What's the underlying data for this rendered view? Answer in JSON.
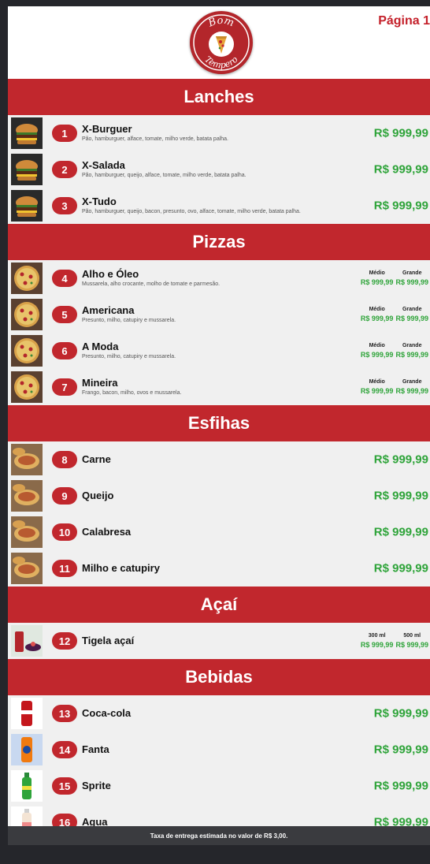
{
  "header": {
    "logo_text_top": "Bom",
    "logo_text_bottom": "Tempero",
    "page_label": "Página 1"
  },
  "sections": [
    {
      "title": "Lanches",
      "items": [
        {
          "number": "1",
          "name": "X-Burguer",
          "description": "Pão, hamburguer, alface, tomate, milho verde, batata palha.",
          "price": "R$ 999,99",
          "thumb": "burger-photo"
        },
        {
          "number": "2",
          "name": "X-Salada",
          "description": "Pão, hamburguer, queijo, alface, tomate, milho verde, batata palha.",
          "price": "R$ 999,99",
          "thumb": "burger-photo"
        },
        {
          "number": "3",
          "name": "X-Tudo",
          "description": "Pão, hamburguer, queijo, bacon, presunto, ovo, alface, tomate, milho verde, batata palha.",
          "price": "R$ 999,99",
          "thumb": "burger-photo"
        }
      ]
    },
    {
      "title": "Pizzas",
      "items": [
        {
          "number": "4",
          "name": "Alho e Óleo",
          "description": "Mussarela, alho crocante, molho de tomate e parmesão.",
          "label_a": "Médio",
          "price_a": "R$ 999,99",
          "label_b": "Grande",
          "price_b": "R$ 999,99",
          "thumb": "pizza-photo"
        },
        {
          "number": "5",
          "name": "Americana",
          "description": "Presunto, milho, catupiry e mussarela.",
          "label_a": "Médio",
          "price_a": "R$ 999,99",
          "label_b": "Grande",
          "price_b": "R$ 999,99",
          "thumb": "pizza-photo"
        },
        {
          "number": "6",
          "name": "A Moda",
          "description": "Presunto, milho, catupiry e mussarela.",
          "label_a": "Médio",
          "price_a": "R$ 999,99",
          "label_b": "Grande",
          "price_b": "R$ 999,99",
          "thumb": "pizza-photo"
        },
        {
          "number": "7",
          "name": "Mineira",
          "description": "Frango, bacon, milho, ovos e mussarela.",
          "label_a": "Médio",
          "price_a": "R$ 999,99",
          "label_b": "Grande",
          "price_b": "R$ 999,99",
          "thumb": "pizza-photo"
        }
      ]
    },
    {
      "title": "Esfihas",
      "items": [
        {
          "number": "8",
          "name": "Carne",
          "price": "R$ 999,99",
          "thumb": "esfiha-photo"
        },
        {
          "number": "9",
          "name": "Queijo",
          "price": "R$ 999,99",
          "thumb": "esfiha-photo"
        },
        {
          "number": "10",
          "name": "Calabresa",
          "price": "R$ 999,99",
          "thumb": "esfiha-photo"
        },
        {
          "number": "11",
          "name": "Milho e catupiry",
          "price": "R$ 999,99",
          "thumb": "esfiha-photo"
        }
      ]
    },
    {
      "title": "Açaí",
      "items": [
        {
          "number": "12",
          "name": "Tigela açaí",
          "label_a": "300 ml",
          "price_a": "R$ 999,99",
          "label_b": "500 ml",
          "price_b": "R$ 999,99",
          "thumb": "acai-photo"
        }
      ]
    },
    {
      "title": "Bebidas",
      "items": [
        {
          "number": "13",
          "name": "Coca-cola",
          "price": "R$ 999,99",
          "thumb": "coca-cola-can"
        },
        {
          "number": "14",
          "name": "Fanta",
          "price": "R$ 999,99",
          "thumb": "fanta-can"
        },
        {
          "number": "15",
          "name": "Sprite",
          "price": "R$ 999,99",
          "thumb": "sprite-bottle"
        },
        {
          "number": "16",
          "name": "Agua",
          "price": "R$ 999,99",
          "thumb": "water-bottle"
        }
      ]
    }
  ],
  "footer": {
    "text": "Taxa de entrega estimada no valor de R$ 3,00."
  },
  "colors": {
    "accent": "#c1272d",
    "price": "#2fa43a",
    "row_bg": "#f0f0f0",
    "footer_bg": "#3a3b3f"
  }
}
